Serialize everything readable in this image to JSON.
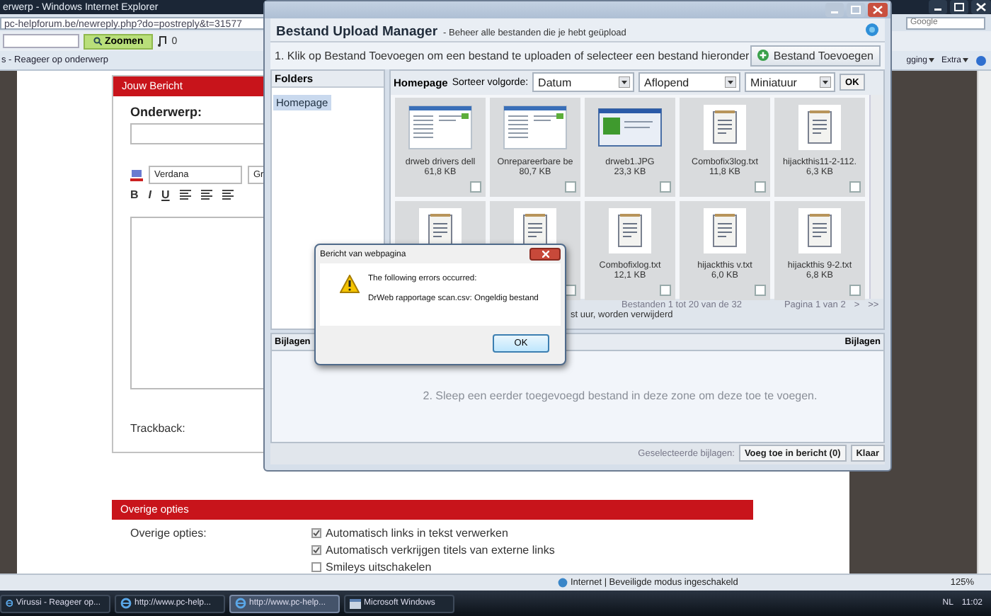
{
  "browser": {
    "title": "erwerp - Windows Internet Explorer",
    "address": "pc-helpforum.be/newreply.php?do=postreply&t=31577",
    "search": {
      "placeholder": "Google"
    },
    "toolbar": {
      "search_button": "Zoomen",
      "counter": "0"
    },
    "tab": {
      "label": "s - Reageer op onderwerp"
    },
    "menus": [
      {
        "label": "gging"
      },
      {
        "label": "Extra"
      }
    ]
  },
  "post_form": {
    "header": "Jouw Bericht",
    "subject_label": "Onderwerp:",
    "font_select": "Verdana",
    "size_select": "Gr",
    "format_buttons": [
      "B",
      "I",
      "U"
    ],
    "trackback_label": "Trackback:"
  },
  "other_options": {
    "header": "Overige opties",
    "label": "Overige opties:",
    "options": [
      {
        "label": "Automatisch links in tekst verwerken",
        "checked": true
      },
      {
        "label": "Automatisch verkrijgen titels van externe links",
        "checked": true
      },
      {
        "label": "Smileys uitschakelen",
        "checked": false
      }
    ]
  },
  "status_bar": {
    "zone": "Internet | Beveiligde modus ingeschakeld",
    "zoom": "125%"
  },
  "taskbar": {
    "items": [
      {
        "label": "Virussi - Reageer op...",
        "selected": false,
        "kind": "browser"
      },
      {
        "label": "http://www.pc-help...",
        "selected": false,
        "kind": "browser"
      },
      {
        "label": "http://www.pc-help...",
        "selected": true,
        "kind": "browser"
      },
      {
        "label": "Microsoft Windows",
        "selected": false,
        "kind": "dialog"
      }
    ],
    "language": "NL",
    "clock": "11:02"
  },
  "upload_manager": {
    "title": "Bestand Upload Manager",
    "subtitle": "- Beheer alle bestanden die je hebt geüpload",
    "instruction": "1. Klik op Bestand Toevoegen om een bestand te uploaden of selecteer een bestand hieronder",
    "add_button": "Bestand Toevoegen",
    "folders": {
      "header": "Folders",
      "items": [
        {
          "label": "Homepage",
          "selected": true
        }
      ]
    },
    "files": {
      "header": "Homepage",
      "sort_label": "Sorteer volgorde:",
      "selects": [
        "Datum",
        "Aflopend",
        "Miniatuur"
      ],
      "ok_button": "OK",
      "items": [
        {
          "kind": "screenshot",
          "name": "drweb drivers dell",
          "size": "61,8 KB",
          "checked": false
        },
        {
          "kind": "screenshot",
          "name": "Onrepareerbare be",
          "size": "80,7 KB",
          "checked": false
        },
        {
          "kind": "image",
          "name": "drweb1.JPG",
          "size": "23,3 KB",
          "checked": false
        },
        {
          "kind": "text",
          "name": "Combofix3log.txt",
          "size": "11,8 KB",
          "checked": false
        },
        {
          "kind": "text",
          "name": "hijackthis11-2-112.",
          "size": "6,3 KB",
          "checked": false
        },
        {
          "kind": "text"
        },
        {
          "kind": "text",
          "checked": false
        },
        {
          "kind": "text",
          "name": "Combofixlog.txt",
          "size": "12,1 KB",
          "checked": false
        },
        {
          "kind": "text",
          "name": "hijackthis v.txt",
          "size": "6,0 KB",
          "checked": false
        },
        {
          "kind": "text",
          "name": "hijackthis 9-2.txt",
          "size": "6,8 KB",
          "checked": false
        }
      ],
      "range": "Bestanden 1 tot 20 van de 32",
      "page": "Pagina 1 van 2",
      "next": ">",
      "last": ">>",
      "notice": "st uur, worden verwijderd"
    },
    "attachments": {
      "header_left": "Bijlagen",
      "header_right": "Bijlagen",
      "drop_hint": "2. Sleep een eerder toegevoegd bestand in deze zone om deze toe te voegen.",
      "selected_label": "Geselecteerde bijlagen:",
      "insert_button": "Voeg toe in bericht (0)",
      "done_button": "Klaar"
    }
  },
  "dialog": {
    "title": "Bericht van webpagina",
    "message": "The following errors occurred:",
    "detail": "DrWeb rapportage scan.csv: Ongeldig bestand",
    "ok_button": "OK"
  }
}
